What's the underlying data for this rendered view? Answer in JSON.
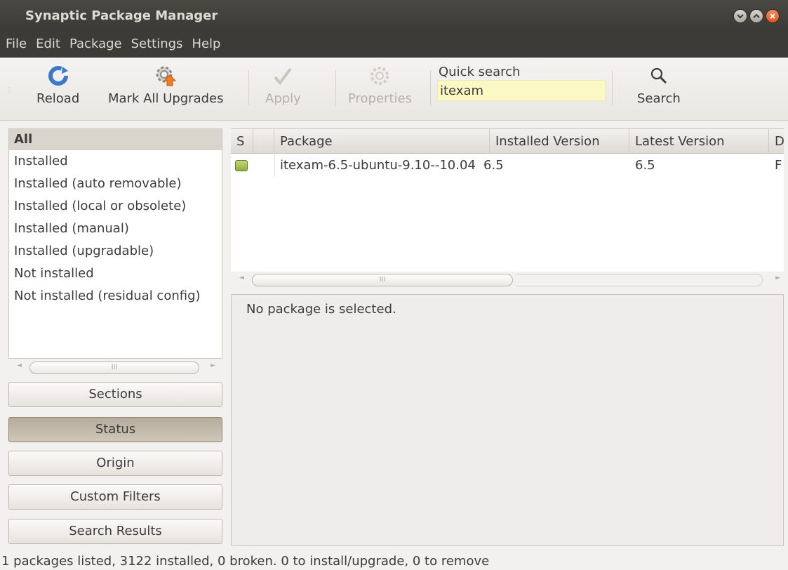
{
  "window": {
    "title": "Synaptic Package Manager",
    "controls": [
      "minimize-icon",
      "maximize-icon",
      "close-icon"
    ]
  },
  "menu": [
    "File",
    "Edit",
    "Package",
    "Settings",
    "Help"
  ],
  "toolbar": {
    "reload": "Reload",
    "mark_all_upgrades": "Mark All Upgrades",
    "apply": "Apply",
    "properties": "Properties",
    "quick_search_label": "Quick search",
    "quick_search_value": "itexam",
    "search": "Search"
  },
  "filters": {
    "items": [
      "All",
      "Installed",
      "Installed (auto removable)",
      "Installed (local or obsolete)",
      "Installed (manual)",
      "Installed (upgradable)",
      "Not installed",
      "Not installed (residual config)"
    ],
    "selected": "All",
    "scroll_thumb": "III"
  },
  "side_buttons": {
    "sections": "Sections",
    "status": "Status",
    "origin": "Origin",
    "custom_filters": "Custom Filters",
    "search_results": "Search Results",
    "active": "Status"
  },
  "package_table": {
    "columns": [
      "S",
      "Package",
      "Installed Version",
      "Latest Version",
      "D"
    ],
    "rows": [
      {
        "status": "installed",
        "package": "itexam-6.5-ubuntu-9.10--10.04",
        "installed_version": "6.5",
        "latest_version": "6.5",
        "description": "F"
      }
    ],
    "scroll_thumb": "III"
  },
  "details": {
    "message": "No package is selected."
  },
  "statusbar": "1 packages listed, 3122 installed, 0 broken. 0 to install/upgrade, 0 to remove",
  "colors": {
    "titlebar": "#3c3b37",
    "close_button": "#e2541b",
    "search_field": "#fbf8c4",
    "installed_status": "#93ad3d"
  }
}
